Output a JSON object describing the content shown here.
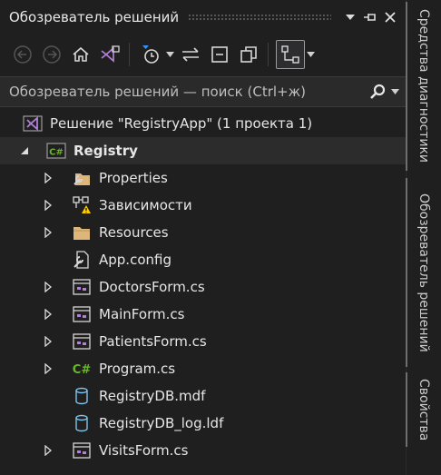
{
  "panel": {
    "title": "Обозреватель решений"
  },
  "search": {
    "placeholder": "Обозреватель решений — поиск (Ctrl+ж)"
  },
  "tree": {
    "solution_label": "Решение \"RegistryApp\"  (1 проекта 1)",
    "project_label": "Registry",
    "items": [
      {
        "label": "Properties",
        "icon": "wrench-folder-icon"
      },
      {
        "label": "Зависимости",
        "icon": "dependencies-warning-icon"
      },
      {
        "label": "Resources",
        "icon": "folder-icon"
      },
      {
        "label": "App.config",
        "icon": "config-file-icon"
      },
      {
        "label": "DoctorsForm.cs",
        "icon": "form-icon"
      },
      {
        "label": "MainForm.cs",
        "icon": "form-icon"
      },
      {
        "label": "PatientsForm.cs",
        "icon": "form-icon"
      },
      {
        "label": "Program.cs",
        "icon": "csharp-file-icon"
      },
      {
        "label": "RegistryDB.mdf",
        "icon": "database-icon"
      },
      {
        "label": "RegistryDB_log.ldf",
        "icon": "database-icon"
      },
      {
        "label": "VisitsForm.cs",
        "icon": "form-icon"
      }
    ]
  },
  "side_tabs": [
    {
      "label": "Средства диагностики"
    },
    {
      "label": "Обозреватель решений"
    },
    {
      "label": "Свойства"
    }
  ],
  "colors": {
    "background": "#1f1f1f",
    "selection": "#2c2c2c",
    "vs_purple": "#b180d7",
    "folder": "#dcb67a",
    "warning": "#ffcc00",
    "csharp_green": "#68b723"
  }
}
